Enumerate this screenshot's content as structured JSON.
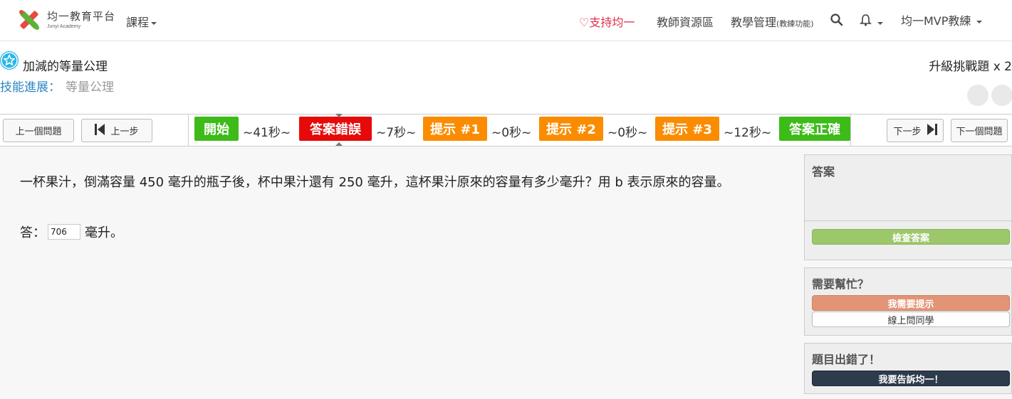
{
  "nav": {
    "logo_cn": "均一教育平台",
    "logo_en": "Junyi Academy",
    "courses": "課程",
    "support": "支持均一",
    "teacher_resources": "教師資源區",
    "teaching_manage": "教學管理",
    "teaching_manage_note": "(教練功能)",
    "user": "均一MVP教練"
  },
  "skill": {
    "title": "加減的等量公理",
    "progress_label": "技能進展：",
    "progress_value": "等量公理",
    "challenge": "升級挑戰題 x 2"
  },
  "timeline": {
    "prev_question": "上一個問題",
    "prev_step": "上一步",
    "next_step": "下一步",
    "next_question": "下一個問題",
    "events": [
      "開始",
      "答案錯誤",
      "提示 #1",
      "提示 #2",
      "提示 #3",
      "答案正確"
    ],
    "gaps": [
      "~41秒~",
      "~7秒~",
      "~0秒~",
      "~0秒~",
      "~12秒~"
    ]
  },
  "problem": {
    "question": "一杯果汁，倒滿容量 450 毫升的瓶子後，杯中果汁還有 250 毫升，這杯果汁原來的容量有多少毫升？用 b 表示原來的容量。",
    "answer_prefix": "答：",
    "answer_value": "706",
    "answer_suffix": "毫升。"
  },
  "sidebar": {
    "answer_title": "答案",
    "check_answer": "檢查答案",
    "help_title": "需要幫忙？",
    "need_hint": "我需要提示",
    "ask_classmate": "線上問同學",
    "error_title": "題目出錯了！",
    "report": "我要告訴均一！"
  }
}
